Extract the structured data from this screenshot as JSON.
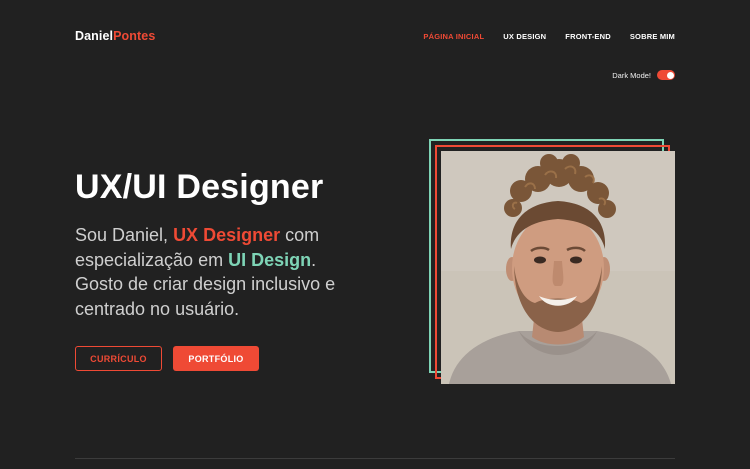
{
  "header": {
    "logo_first": "Daniel",
    "logo_last": "Pontes",
    "nav": [
      {
        "label": "PÁGINA INICIAL",
        "active": true
      },
      {
        "label": "UX DESIGN",
        "active": false
      },
      {
        "label": "FRONT-END",
        "active": false
      },
      {
        "label": "SOBRE MIM",
        "active": false
      }
    ]
  },
  "dark_mode": {
    "label": "Dark Mode!",
    "enabled": true
  },
  "hero": {
    "title": "UX/UI Designer",
    "text_1": "Sou Daniel, ",
    "text_hl_1": "UX Designer",
    "text_2": " com especialização em ",
    "text_hl_2": "UI Design",
    "text_3": ". Gosto de criar design inclusivo e centrado no usuário.",
    "button_outline": "CURRÍCULO",
    "button_solid": "PORTFÓLIO"
  },
  "colors": {
    "background": "#212121",
    "accent_red": "#ef4a35",
    "accent_green": "#7ed4b6",
    "text": "#ffffff"
  },
  "icons": {
    "profile_photo": "portrait-photo",
    "toggle": "toggle-switch"
  }
}
